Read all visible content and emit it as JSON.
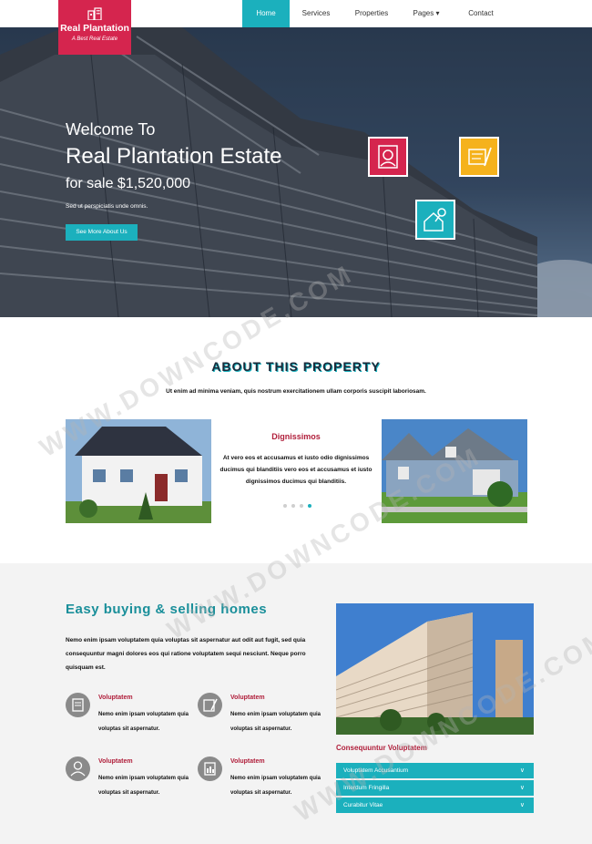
{
  "logo": {
    "title": "Real Plantation",
    "subtitle": "A Best Real Estate",
    "icon": "building-icon"
  },
  "nav": {
    "items": [
      {
        "label": "Home",
        "active": true
      },
      {
        "label": "Services",
        "active": false
      },
      {
        "label": "Properties",
        "active": false
      },
      {
        "label": "Pages ▾",
        "active": false
      },
      {
        "label": "Contact",
        "active": false
      }
    ]
  },
  "hero": {
    "welcome": "Welcome To",
    "title": "Real Plantation Estate",
    "price": "for sale $1,520,000",
    "desc": "Sed ut perspiciatis unde omnis.",
    "button": "See More About Us",
    "icons": [
      "architect-icon",
      "blueprint-icon",
      "house-key-icon"
    ]
  },
  "about": {
    "title": "ABOUT THIS PROPERTY",
    "intro": "Ut enim ad minima veniam, quis nostrum exercitationem ullam corporis suscipit laboriosam.",
    "center_title": "Dignissimos",
    "center_text": "At vero eos et accusamus et iusto odio dignissimos ducimus qui blanditiis vero eos et accusamus et iusto dignissimos ducimus qui blanditiis.",
    "carousel_dots": 4,
    "active_dot": 3
  },
  "easy": {
    "title": "Easy buying & selling homes",
    "desc": "Nemo enim ipsam voluptatem quia voluptas sit aspernatur aut odit aut fugit, sed quia consequuntur magni dolores eos qui ratione voluptatem sequi nesciunt. Neque porro quisquam est.",
    "features": [
      {
        "title": "Voluptatem",
        "text": "Nemo enim ipsam voluptatem quia voluptas sit aspernatur.",
        "icon": "document-icon"
      },
      {
        "title": "Voluptatem",
        "text": "Nemo enim ipsam voluptatem quia voluptas sit aspernatur.",
        "icon": "contract-icon"
      },
      {
        "title": "Voluptatem",
        "text": "Nemo enim ipsam voluptatem quia voluptas sit aspernatur.",
        "icon": "agent-icon"
      },
      {
        "title": "Voluptatem",
        "text": "Nemo enim ipsam voluptatem quia voluptas sit aspernatur.",
        "icon": "report-icon"
      }
    ],
    "accordion_title": "Consequuntur Voluptatem",
    "accordion": [
      "Voluptatem Accusantium",
      "Interdum Fringilla",
      "Curabitur Vitae"
    ]
  },
  "watermark": "WWW.DOWNCODE.COM",
  "colors": {
    "accent": "#1bb0bd",
    "brand": "#d5254e",
    "heading_red": "#b01e3a"
  }
}
